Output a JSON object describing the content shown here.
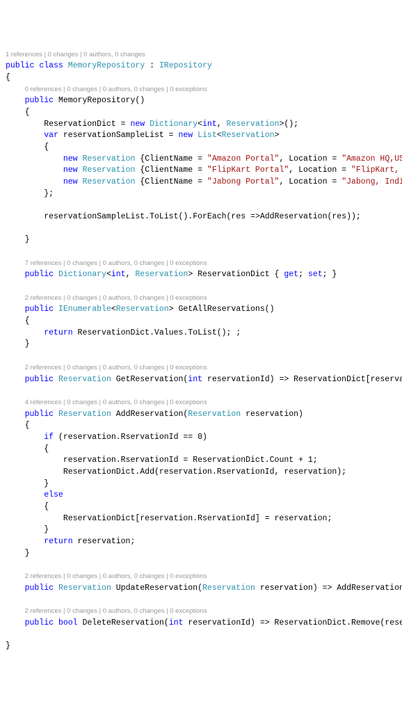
{
  "lens": {
    "class": "1 references | 0 changes | 0 authors, 0 changes",
    "ctor": "0 references | 0 changes | 0 authors, 0 changes | 0 exceptions",
    "dict": "7 references | 0 changes | 0 authors, 0 changes | 0 exceptions",
    "getall": "2 references | 0 changes | 0 authors, 0 changes | 0 exceptions",
    "getres": "2 references | 0 changes | 0 authors, 0 changes | 0 exceptions",
    "addres": "4 references | 0 changes | 0 authors, 0 changes | 0 exceptions",
    "updres": "2 references | 0 changes | 0 authors, 0 changes | 0 exceptions",
    "delres": "2 references | 0 changes | 0 authors, 0 changes | 0 exceptions"
  },
  "kw": {
    "public": "public",
    "class": "class",
    "new": "new",
    "var": "var",
    "return": "return",
    "if": "if",
    "else": "else",
    "get": "get",
    "set": "set",
    "int": "int",
    "bool": "bool"
  },
  "types": {
    "MemoryRepository": "MemoryRepository",
    "IRepository": "IRepository",
    "Dictionary": "Dictionary",
    "Reservation": "Reservation",
    "List": "List",
    "IEnumerable": "IEnumerable"
  },
  "ids": {
    "ReservationDict": "ReservationDict",
    "reservationSampleList": "reservationSampleList",
    "ClientName": "ClientName",
    "Location": "Location",
    "ToList": "ToList",
    "ForEach": "ForEach",
    "res": "res",
    "AddReservation": "AddReservation",
    "GetAllReservations": "GetAllReservations",
    "Values": "Values",
    "GetReservation": "GetReservation",
    "reservationId": "reservationId",
    "reservation": "reservation",
    "RservationId": "RservationId",
    "Count": "Count",
    "Add": "Add",
    "UpdateReservation": "UpdateReservation",
    "DeleteReservation": "DeleteReservation",
    "Remove": "Remove"
  },
  "str": {
    "amzP": "\"Amazon Portal\"",
    "amzL": "\"Amazon HQ,USA\"",
    "fkP": "\"FlipKart Portal\"",
    "fkL": "\"FlipKart, India\"",
    "jbP": "\"Jabong Portal\"",
    "jbL": "\"Jabong, India\""
  },
  "num": {
    "zero": "0",
    "one": "1"
  }
}
